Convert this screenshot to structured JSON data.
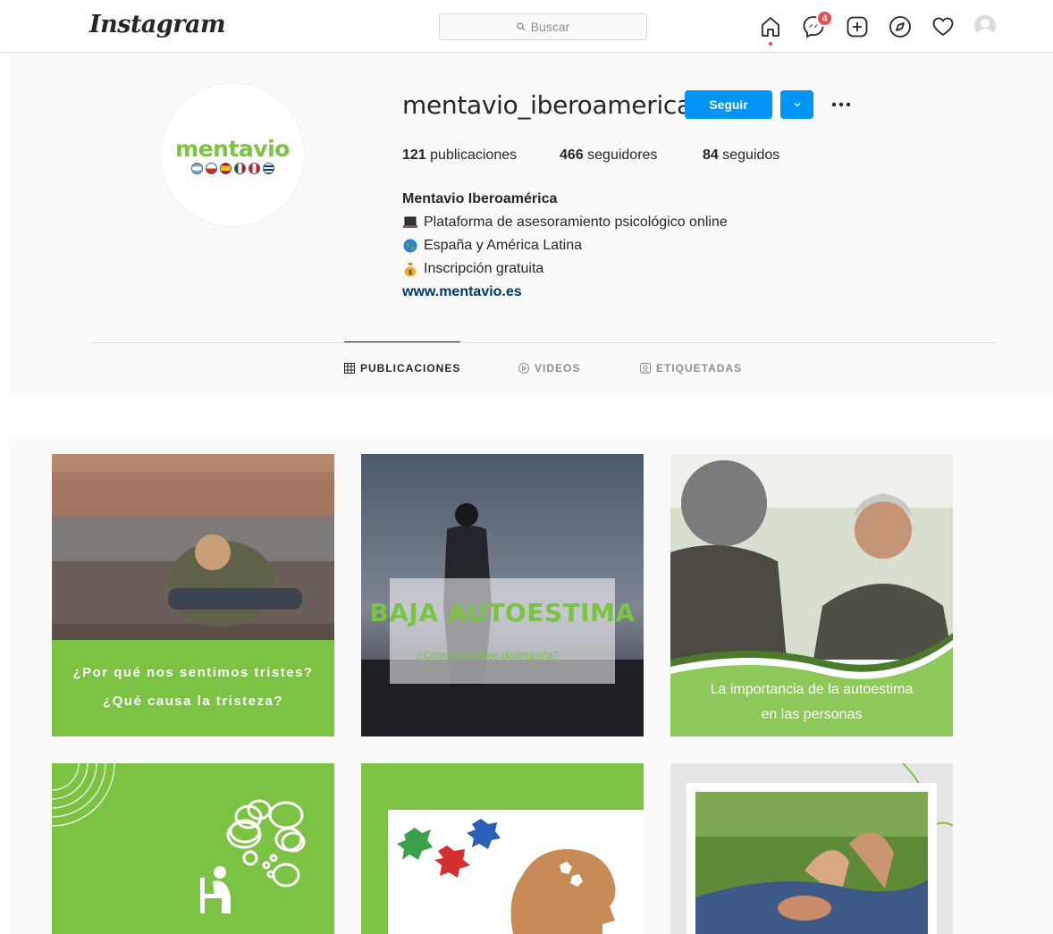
{
  "nav": {
    "logo": "Instagram",
    "search_placeholder": "Buscar",
    "messages_badge": "4",
    "icons": [
      "home-icon",
      "messenger-icon",
      "new-post-icon",
      "explore-icon",
      "activity-icon",
      "profile-avatar"
    ]
  },
  "profile": {
    "username": "mentavio_iberoamerica",
    "follow_label": "Seguir",
    "more_label": "•••",
    "avatar_brand": "mentavio",
    "stats": {
      "posts_count": "121",
      "posts_label": "publicaciones",
      "followers_count": "466",
      "followers_label": "seguidores",
      "following_count": "84",
      "following_label": "seguidos"
    },
    "bio": {
      "name": "Mentavio Iberoamérica",
      "line1": "Plataforma de asesoramiento psicológico online",
      "line2": "España y América Latina",
      "line3": "Inscripción gratuita",
      "link": "www.mentavio.es"
    }
  },
  "tabs": [
    {
      "label": "PUBLICACIONES",
      "active": true
    },
    {
      "label": "VIDEOS",
      "active": false
    },
    {
      "label": "ETIQUETADAS",
      "active": false
    }
  ],
  "posts": [
    {
      "caption_line1": "¿Por qué nos sentimos tristes?",
      "caption_line2": "¿Qué causa la tristeza?"
    },
    {
      "title": "BAJA AUTOESTIMA",
      "subtitle": "¿Cómo podemos distinguirla?"
    },
    {
      "caption_line1": "La importancia de la autoestima",
      "caption_line2": "en las personas"
    },
    {},
    {},
    {}
  ],
  "colors": {
    "brand_green": "#7cc243",
    "follow_blue": "#0095f6",
    "badge_red": "#ed4956",
    "link_blue": "#00376b"
  }
}
